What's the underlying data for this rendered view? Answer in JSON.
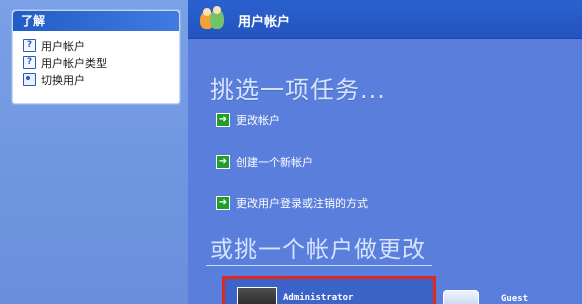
{
  "left_panel": {
    "title": "了解",
    "items": [
      {
        "label": "用户帐户",
        "icon": "help-icon"
      },
      {
        "label": "用户帐户类型",
        "icon": "help-icon"
      },
      {
        "label": "切换用户",
        "icon": "switch-user-icon"
      }
    ]
  },
  "main": {
    "topbar_title": "用户帐户",
    "heading": "挑选一项任务...",
    "tasks": [
      {
        "label": "更改帐户"
      },
      {
        "label": "创建一个新帐户"
      },
      {
        "label": "更改用户登录或注销的方式"
      }
    ],
    "subheading": "或挑一个帐户做更改",
    "accounts": [
      {
        "name": "Administrator",
        "selected": true
      },
      {
        "name": "Guest",
        "selected": false
      }
    ]
  },
  "colors": {
    "main_bg": "#5a7edc",
    "topbar": "#2b61cf",
    "left_bg": "#7aa1e6",
    "highlight_border": "#e0281f",
    "task_icon": "#1f9f2a"
  }
}
